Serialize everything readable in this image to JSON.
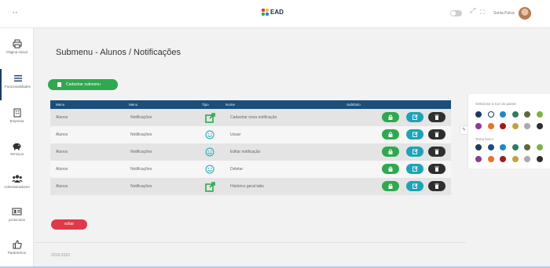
{
  "header": {
    "menu_dots": "▪▪",
    "brand": "EAD",
    "user_name": "Sonia Paiva"
  },
  "sidebar": {
    "items": [
      {
        "label": "Página inicial",
        "icon": "printer-icon"
      },
      {
        "label": "Funcionalidades",
        "icon": "list-icon"
      },
      {
        "label": "Empresa",
        "icon": "building-icon"
      },
      {
        "label": "Serviços",
        "icon": "piggy-bank-icon"
      },
      {
        "label": "Administradores",
        "icon": "users-icon"
      },
      {
        "label": "protocolos",
        "icon": "id-card-icon"
      },
      {
        "label": "Parâmetros",
        "icon": "thumbs-up-icon"
      }
    ]
  },
  "page": {
    "title": "Submenu - Alunos / Notificações",
    "add_button": "Cadastrar submenu",
    "back_button": "voltar",
    "footer": "2018-2023"
  },
  "table": {
    "headers": {
      "menu": "Menu",
      "submenu": "Menu",
      "tipo": "Tipo",
      "nome": "Nome",
      "subtitle": "Subtítulo"
    },
    "rows": [
      {
        "menu": "Alunos",
        "submenu": "Notificações",
        "tipo": "external-link-icon",
        "nome": "Cadastrar nova notificação"
      },
      {
        "menu": "Alunos",
        "submenu": "Notificações",
        "tipo": "smiley-icon",
        "nome": "Usuar"
      },
      {
        "menu": "Alunos",
        "submenu": "Notificações",
        "tipo": "smiley-icon",
        "nome": "Editar notificação"
      },
      {
        "menu": "Alunos",
        "submenu": "Notificações",
        "tipo": "smiley-icon",
        "nome": "Deletar"
      },
      {
        "menu": "Alunos",
        "submenu": "Notificações",
        "tipo": "external-link-icon",
        "nome": "Histórico geral tabs"
      }
    ]
  },
  "panel": {
    "label_1": "Selecione a Cor do painel",
    "label_2": "Tema fosco",
    "colors_1": [
      "#1b3a66",
      "#ffffff",
      "#1e88c8",
      "#2e7d5b",
      "#5a6b3a",
      "#7cb342",
      "#8e3a8f",
      "#e8722a",
      "#a01c1c",
      "#c4a23a",
      "#aaaaaa",
      "#2f2f2f"
    ],
    "colors_2": [
      "#1b3a66",
      "#1b4f7a",
      "#1e88c8",
      "#2e7d5b",
      "#5a6b3a",
      "#7cb342",
      "#8e3a8f",
      "#e8722a",
      "#a01c1c",
      "#c4a23a",
      "#aaaaaa",
      "#2f2f2f"
    ]
  },
  "colors": {
    "green": "#2fa84f",
    "teal": "#1ea3b8",
    "dark": "#2f2f2f",
    "red": "#e0394a",
    "table_header": "#1b4f7a"
  }
}
